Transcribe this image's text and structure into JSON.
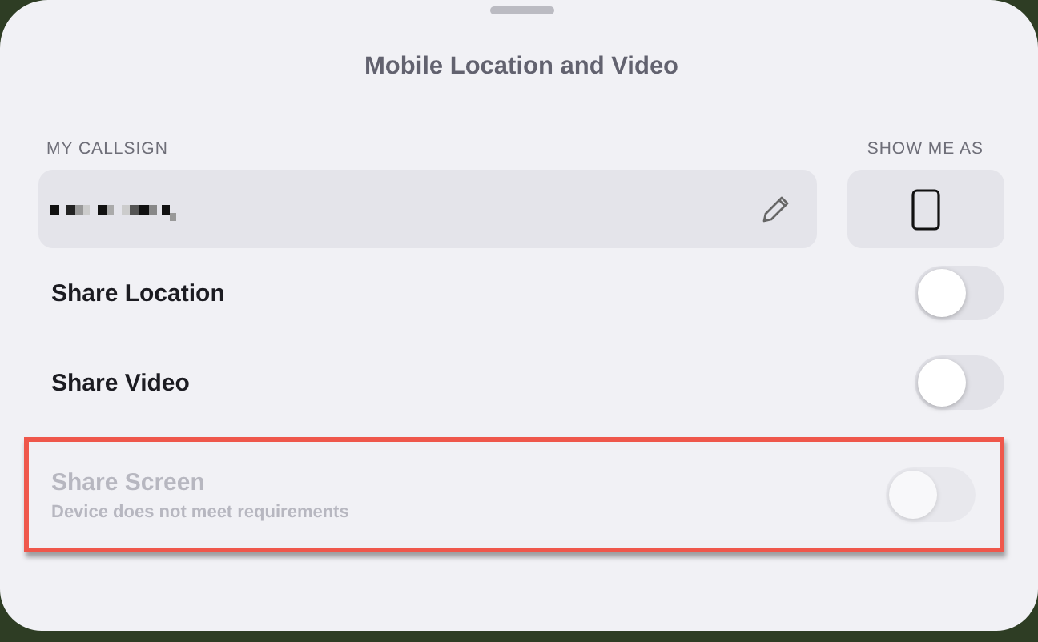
{
  "sheet": {
    "title": "Mobile Location and Video"
  },
  "callsign": {
    "label": "MY CALLSIGN",
    "redacted": true
  },
  "show_me_as": {
    "label": "SHOW ME AS"
  },
  "toggles": [
    {
      "label": "Share Location",
      "on": false,
      "disabled": false,
      "highlighted": false
    },
    {
      "label": "Share Video",
      "on": false,
      "disabled": false,
      "highlighted": false
    },
    {
      "label": "Share Screen",
      "note": "Device does not meet requirements",
      "on": false,
      "disabled": true,
      "highlighted": true
    }
  ]
}
